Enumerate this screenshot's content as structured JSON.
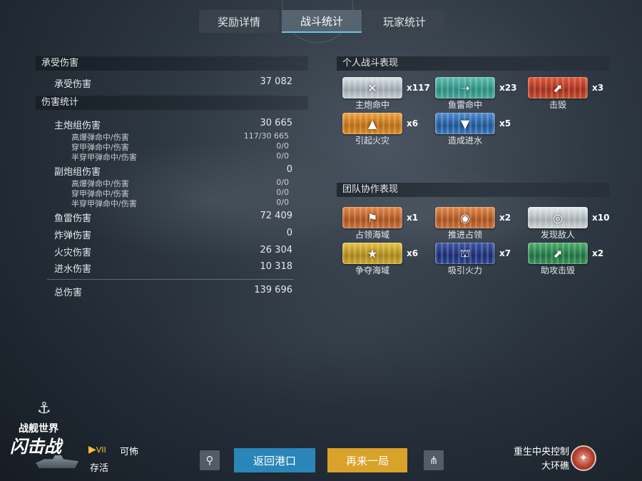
{
  "tabs": [
    {
      "label": "奖励详情"
    },
    {
      "label": "战斗统计"
    },
    {
      "label": "玩家统计"
    }
  ],
  "damage_received": {
    "header": "承受伤害",
    "row": {
      "label": "承受伤害",
      "value": "37 082"
    }
  },
  "damage_stats": {
    "header": "伤害统计",
    "main_battery": {
      "label": "主炮组伤害",
      "value": "30 665"
    },
    "main_sub": [
      {
        "label": "高爆弹命中/伤害",
        "value": "117/30 665"
      },
      {
        "label": "穿甲弹命中/伤害",
        "value": "0/0"
      },
      {
        "label": "半穿甲弹命中/伤害",
        "value": "0/0"
      }
    ],
    "secondary": {
      "label": "副炮组伤害",
      "value": "0"
    },
    "secondary_sub": [
      {
        "label": "高爆弹命中/伤害",
        "value": "0/0"
      },
      {
        "label": "穿甲弹命中/伤害",
        "value": "0/0"
      },
      {
        "label": "半穿甲弹命中/伤害",
        "value": "0/0"
      }
    ],
    "torpedo": {
      "label": "鱼雷伤害",
      "value": "72 409"
    },
    "bomb": {
      "label": "炸弹伤害",
      "value": "0"
    },
    "fire": {
      "label": "火灾伤害",
      "value": "26 304"
    },
    "flood": {
      "label": "进水伤害",
      "value": "10 318"
    },
    "total": {
      "label": "总伤害",
      "value": "139 696"
    }
  },
  "personal": {
    "header": "个人战斗表现",
    "medals": [
      {
        "label": "主炮命中",
        "count": "x117",
        "icon": "crossed-shells-icon",
        "color": "silver"
      },
      {
        "label": "鱼雷命中",
        "count": "x23",
        "icon": "torpedo-icon",
        "color": "teal"
      },
      {
        "label": "击毁",
        "count": "x3",
        "icon": "sinking-ship-icon",
        "color": "red"
      },
      {
        "label": "引起火灾",
        "count": "x6",
        "icon": "fire-icon",
        "color": "orange"
      },
      {
        "label": "造成进水",
        "count": "x5",
        "icon": "flood-icon",
        "color": "blue"
      }
    ]
  },
  "team": {
    "header": "团队协作表现",
    "medals": [
      {
        "label": "占领海域",
        "count": "x1",
        "icon": "flag-icon",
        "color": "bronze"
      },
      {
        "label": "推进占领",
        "count": "x2",
        "icon": "capture-circle-icon",
        "color": "bronze"
      },
      {
        "label": "发现敌人",
        "count": "x10",
        "icon": "radar-icon",
        "color": "gray"
      },
      {
        "label": "争夺海域",
        "count": "x6",
        "icon": "contest-star-icon",
        "color": "gold"
      },
      {
        "label": "吸引火力",
        "count": "x7",
        "icon": "tank-ship-icon",
        "color": "navy"
      },
      {
        "label": "助攻击毁",
        "count": "x2",
        "icon": "assist-kill-icon",
        "color": "green"
      }
    ]
  },
  "logo": {
    "line1": "战舰世界",
    "line2": "闪击战"
  },
  "player": {
    "tier": "VII",
    "ship": "可怖",
    "mode": "存活"
  },
  "buttons": {
    "back": "返回港口",
    "again": "再来一局"
  },
  "map": {
    "line1": "重生中央控制",
    "line2": "大环礁"
  }
}
